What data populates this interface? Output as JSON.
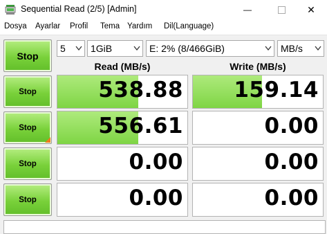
{
  "window": {
    "title": "Sequential Read (2/5) [Admin]",
    "minimize_glyph": "—",
    "close_glyph": "✕"
  },
  "menu": [
    "Dosya",
    "Ayarlar",
    "Profil",
    "Tema",
    "Yardım",
    "Dil(Language)"
  ],
  "controls": {
    "all_button_label": "Stop",
    "count": "5",
    "size": "1GiB",
    "drive": "E: 2% (8/466GiB)",
    "unit": "MB/s"
  },
  "headers": {
    "read": "Read (MB/s)",
    "write": "Write (MB/s)"
  },
  "rows": [
    {
      "button_label": "Stop",
      "read": "538.88",
      "write": "159.14",
      "read_fill": 0.62,
      "write_fill": 0.53,
      "active": false
    },
    {
      "button_label": "Stop",
      "read": "556.61",
      "write": "0.00",
      "read_fill": 0.62,
      "write_fill": 0,
      "active": true
    },
    {
      "button_label": "Stop",
      "read": "0.00",
      "write": "0.00",
      "read_fill": 0,
      "write_fill": 0,
      "active": false
    },
    {
      "button_label": "Stop",
      "read": "0.00",
      "write": "0.00",
      "read_fill": 0,
      "write_fill": 0,
      "active": false
    }
  ],
  "colors": {
    "button_green": "#79d13a",
    "bar_green": "#7fd544",
    "active_marker": "#f07a1e"
  },
  "icons": [
    "app-icon",
    "minimize-icon",
    "maximize-icon",
    "close-icon",
    "dropdown-arrow-icon"
  ]
}
